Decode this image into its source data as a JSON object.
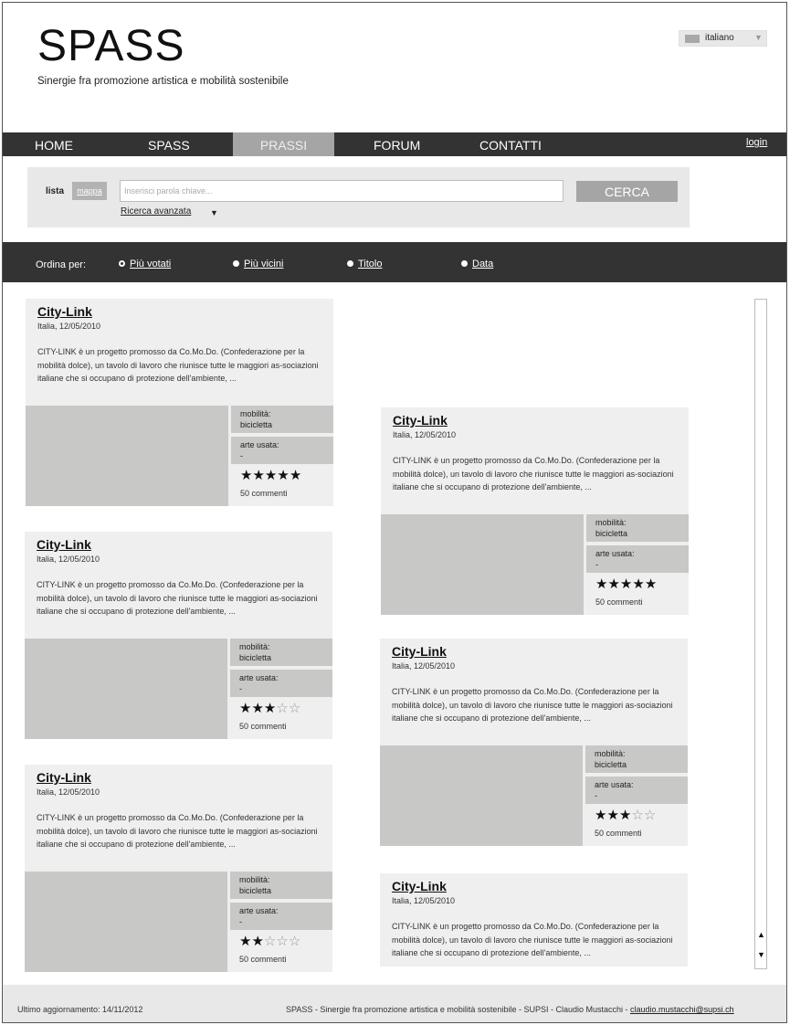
{
  "header": {
    "logo": "SPASS",
    "tagline": "Sinergie fra promozione artistica e mobilità sostenibile",
    "language": "italiano"
  },
  "nav": {
    "items": [
      "HOME",
      "SPASS",
      "PRASSI",
      "FORUM",
      "CONTATTI"
    ],
    "active": "PRASSI",
    "login": "login"
  },
  "search": {
    "view_list": "lista",
    "view_map": "mappa",
    "placeholder": "Inserisci parola chiave...",
    "button": "CERCA",
    "advanced": "Ricerca avanzata"
  },
  "sort": {
    "label": "Ordina per:",
    "options": [
      "Più votati",
      "Più vicini",
      "Titolo",
      "Data"
    ],
    "selected": "Più votati"
  },
  "cards": [
    {
      "title": "City-Link",
      "meta": "Italia, 12/05/2010",
      "desc": "CITY-LINK è un progetto promosso da Co.Mo.Do. (Confederazione per la mobilità dolce), un tavolo di lavoro che riunisce tutte le maggiori as-sociazioni italiane che si occupano di protezione dell'ambiente, ...",
      "mob_label": "mobilità:",
      "mob_value": "bicicletta",
      "art_label": "arte usata:",
      "art_value": "-",
      "rating": 5,
      "comments": "50 commenti"
    },
    {
      "title": "City-Link",
      "meta": "Italia, 12/05/2010",
      "desc": "CITY-LINK è un progetto promosso da Co.Mo.Do. (Confederazione per la mobilità dolce), un tavolo di lavoro che riunisce tutte le maggiori as-sociazioni italiane che si occupano di protezione dell'ambiente, ...",
      "mob_label": "mobilità:",
      "mob_value": "bicicletta",
      "art_label": "arte usata:",
      "art_value": "-",
      "rating": 3,
      "comments": "50 commenti"
    },
    {
      "title": "City-Link",
      "meta": "Italia, 12/05/2010",
      "desc": "CITY-LINK è un progetto promosso da Co.Mo.Do. (Confederazione per la mobilità dolce), un tavolo di lavoro che riunisce tutte le maggiori as-sociazioni italiane che si occupano di protezione dell'ambiente, ...",
      "mob_label": "mobilità:",
      "mob_value": "bicicletta",
      "art_label": "arte usata:",
      "art_value": "-",
      "rating": 2,
      "comments": "50 commenti"
    },
    {
      "title": "City-Link",
      "meta": "Italia, 12/05/2010",
      "desc": "CITY-LINK è un progetto promosso da Co.Mo.Do. (Confederazione per la mobilità dolce), un tavolo di lavoro che riunisce tutte le maggiori as-sociazioni italiane che si occupano di protezione dell'ambiente, ...",
      "mob_label": "mobilità:",
      "mob_value": "bicicletta",
      "art_label": "arte usata:",
      "art_value": "-",
      "rating": 5,
      "comments": "50 commenti"
    },
    {
      "title": "City-Link",
      "meta": "Italia, 12/05/2010",
      "desc": "CITY-LINK è un progetto promosso da Co.Mo.Do. (Confederazione per la mobilità dolce), un tavolo di lavoro che riunisce tutte le maggiori as-sociazioni italiane che si occupano di protezione dell'ambiente, ...",
      "mob_label": "mobilità:",
      "mob_value": "bicicletta",
      "art_label": "arte usata:",
      "art_value": "-",
      "rating": 3,
      "comments": "50 commenti"
    },
    {
      "title": "City-Link",
      "meta": "Italia, 12/05/2010",
      "desc": "CITY-LINK è un progetto promosso da Co.Mo.Do. (Confederazione per la mobilità dolce), un tavolo di lavoro che riunisce tutte le maggiori as-sociazioni italiane che si occupano di protezione dell'ambiente, ...",
      "mob_label": "",
      "mob_value": "",
      "art_label": "",
      "art_value": "",
      "rating": 0,
      "comments": ""
    }
  ],
  "footer": {
    "updated": "Ultimo aggiornamento: 14/11/2012",
    "credits": "SPASS - Sinergie fra promozione artistica e mobilità sostenibile - SUPSI - Claudio Mustacchi - ",
    "email": "claudio.mustacchi@supsi.ch"
  }
}
